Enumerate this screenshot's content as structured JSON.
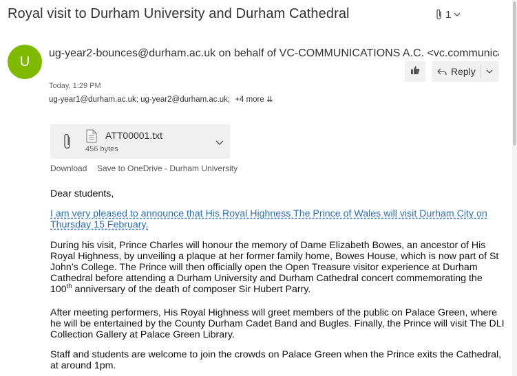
{
  "email": {
    "subject": "Royal visit to Durham University and Durham Cathedral",
    "attachment_count": "1",
    "avatar_initial": "U",
    "avatar_color": "#7fba00",
    "sender": "ug-year2-bounces@durham.ac.uk on behalf of VC-COMMUNICATIONS A.C. <vc.communications@durham.ac.uk>",
    "reply_label": "Reply",
    "time": "Today, 1:29 PM",
    "recipients": "ug-year1@durham.ac.uk; ug-year2@durham.ac.uk;",
    "more_recipients": "+4 more",
    "attachment": {
      "name": "ATT00001.txt",
      "size": "456 bytes",
      "download": "Download",
      "save": "Save to OneDrive - Durham University"
    }
  },
  "body": {
    "greeting": "Dear students,",
    "announce": "I am very pleased to announce that His Royal Highness The Prince of Wales will visit Durham City on Thursday 15 February.",
    "para1_a": "During his visit, Prince Charles will honour the memory of Dame Elizabeth Bowes, an ancestor of His Royal Highness, by unveiling a plaque at her former family home, Bowes House, which is now part of St John’s College. The Prince will then officially open the Open Treasure visitor experience at Durham Cathedral before attending a Durham University and Durham Cathedral concert commemorating the 100",
    "para1_sup": "th",
    "para1_b": " anniversary of the death of composer Sir Hubert Parry.",
    "para2": "After meeting performers, His Royal Highness will greet members of the public on Palace Green, where he will be entertained by the County Durham Cadet Band and Bugles. Finally, the Prince will visit The DLI Collection Gallery at Palace Green Library.",
    "para3": "Staff and students are welcome to join the crowds on Palace Green when the Prince exits the Cathedral, at around 1pm."
  },
  "colors": {
    "link": "#2a6fbf",
    "button_bg": "#f1f1f1",
    "attachment_bg": "#f0f0f0"
  }
}
